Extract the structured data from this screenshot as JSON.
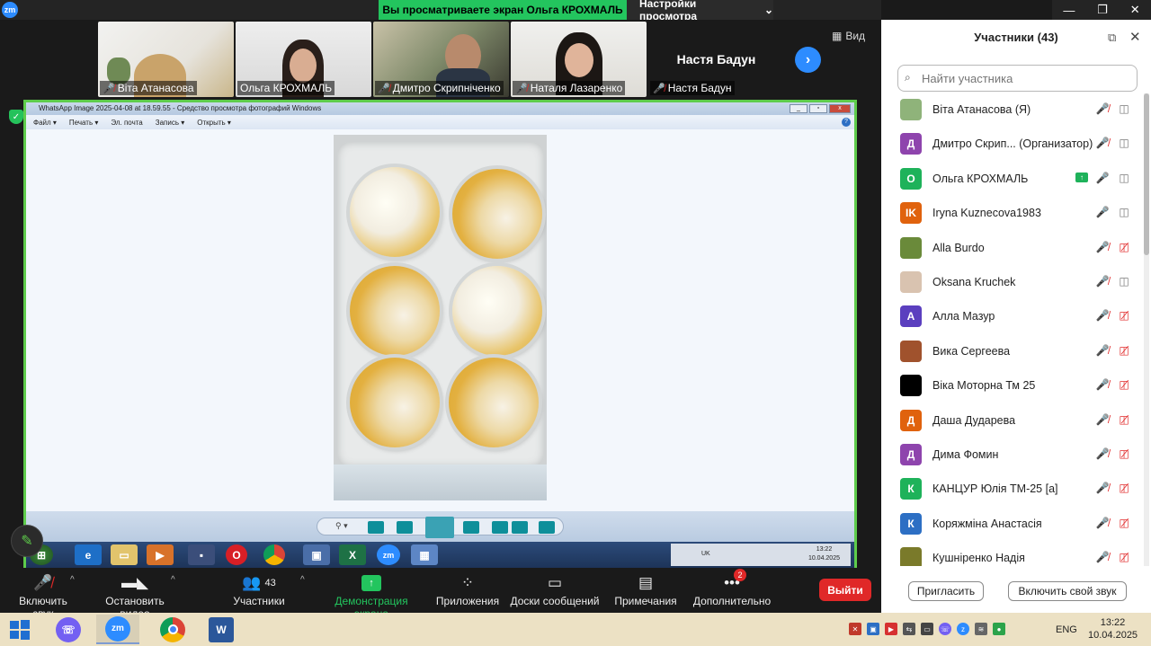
{
  "topbar": {
    "app_logo": "zm",
    "share_banner": "Вы просматриваете экран Ольга КРОХМАЛЬ",
    "view_settings": "Настройки просмотра",
    "view_settings_caret": "⌄",
    "window_controls": [
      "—",
      "❐",
      "✕"
    ]
  },
  "video_strip": {
    "tiles": [
      {
        "name": "Віта Атанасова",
        "muted": true
      },
      {
        "name": "Ольга КРОХМАЛЬ",
        "muted": false
      },
      {
        "name": "Дмитро Скрипніченко",
        "muted": true
      },
      {
        "name": "Наталя Лазаренко",
        "muted": true
      },
      {
        "name": "Настя Бадун",
        "muted": true,
        "big_label": "Настя Бадун"
      }
    ],
    "view_label": "Вид"
  },
  "photo_viewer": {
    "title": "WhatsApp Image 2025-04-08 at 18.59.55 - Средство просмотра фотографий Windows",
    "menu": [
      "Файл ▾",
      "Печать ▾",
      "Эл. почта",
      "Запись ▾",
      "Открыть ▾"
    ],
    "help": "?",
    "zoom": "⚲ ▾",
    "xp_tray_lang": "UK",
    "xp_time": "13:22",
    "xp_date": "10.04.2025"
  },
  "participants_panel": {
    "title": "Участники (43)",
    "search_placeholder": "Найти участника",
    "participants": [
      {
        "name": "Віта Атанасова (Я)",
        "avatar_letter": "",
        "avatar_color": "#8fb37a",
        "mic": "muted",
        "video": "on"
      },
      {
        "name": "Дмитро Скрип...   (Организатор)",
        "avatar_letter": "Д",
        "avatar_color": "#8e44ad",
        "mic": "muted",
        "video": "on"
      },
      {
        "name": "Ольга КРОХМАЛЬ",
        "avatar_letter": "О",
        "avatar_color": "#1eb25a",
        "mic": "active",
        "video": "on",
        "sharing": true
      },
      {
        "name": "Iryna Kuznecova1983",
        "avatar_letter": "IK",
        "avatar_color": "#e0620d",
        "mic": "active",
        "video": "on"
      },
      {
        "name": "Alla Burdo",
        "avatar_letter": "",
        "avatar_color": "#6a8a3a",
        "mic": "muted",
        "video": "off"
      },
      {
        "name": "Oksana Kruchek",
        "avatar_letter": "",
        "avatar_color": "#d9c3b0",
        "mic": "muted",
        "video": "on"
      },
      {
        "name": "Алла Мазур",
        "avatar_letter": "А",
        "avatar_color": "#5b3fbf",
        "mic": "muted",
        "video": "off"
      },
      {
        "name": "Вика Сергеева",
        "avatar_letter": "",
        "avatar_color": "#a0522d",
        "mic": "muted",
        "video": "off"
      },
      {
        "name": "Віка Моторна Тм 25",
        "avatar_letter": "",
        "avatar_color": "#000000",
        "mic": "muted",
        "video": "off"
      },
      {
        "name": "Даша Дударева",
        "avatar_letter": "Д",
        "avatar_color": "#e0620d",
        "mic": "muted",
        "video": "off"
      },
      {
        "name": "Дима Фомин",
        "avatar_letter": "Д",
        "avatar_color": "#8e44ad",
        "mic": "muted",
        "video": "off"
      },
      {
        "name": "КАНЦУР Юлія ТМ-25 [а]",
        "avatar_letter": "К",
        "avatar_color": "#1eb25a",
        "mic": "muted",
        "video": "off"
      },
      {
        "name": "Коряжміна Анастасія",
        "avatar_letter": "К",
        "avatar_color": "#2d6fc4",
        "mic": "muted",
        "video": "off"
      },
      {
        "name": "Кушніренко Надія",
        "avatar_letter": "",
        "avatar_color": "#7a7a2a",
        "mic": "muted",
        "video": "off"
      }
    ],
    "invite_label": "Пригласить",
    "unmute_self_label": "Включить свой звук"
  },
  "toolbar": {
    "unmute": "Включить звук",
    "stop_video": "Остановить видео",
    "participants": "Участники",
    "participants_count": "43",
    "share_screen": "Демонстрация экрана",
    "apps": "Приложения",
    "whiteboards": "Доски сообщений",
    "notes": "Примечания",
    "more": "Дополнительно",
    "more_badge": "2",
    "leave": "Выйти"
  },
  "taskbar": {
    "lang": "ENG",
    "time": "13:22",
    "date": "10.04.2025",
    "zoom_label": "zm"
  },
  "colors": {
    "zoom_blue": "#2d8cff",
    "share_green": "#23c55e",
    "leave_red": "#e02828"
  }
}
